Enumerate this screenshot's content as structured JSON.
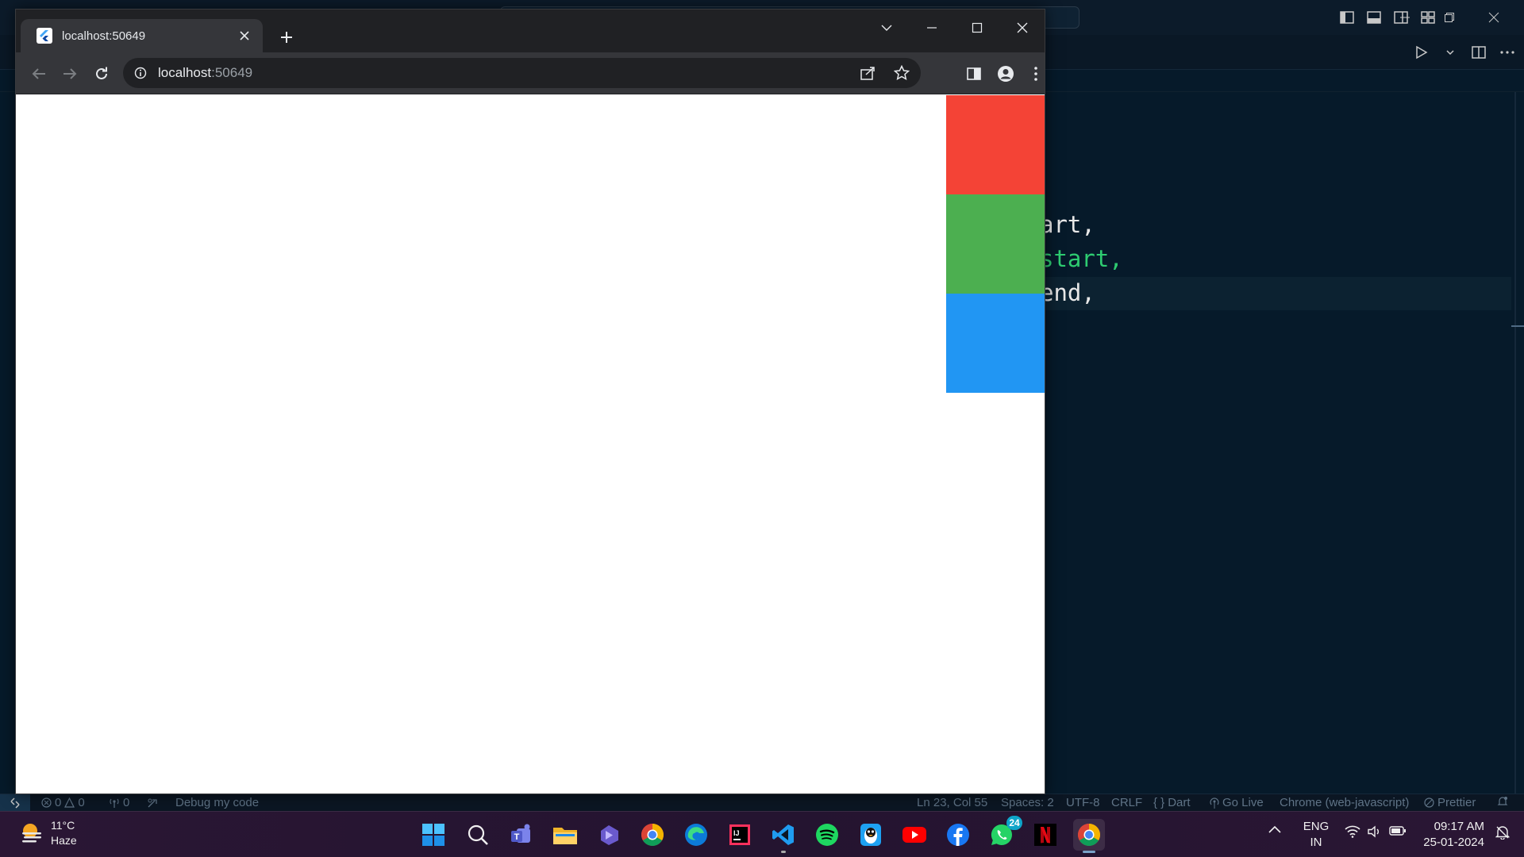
{
  "vscode": {
    "code_lines": [
      {
        "text": "art,",
        "color": "#e8e8e8"
      },
      {
        "text": "start,",
        "color": "#2ecc71"
      },
      {
        "text": "end,",
        "color": "#e8e8e8"
      }
    ],
    "statusbar": {
      "errors": "0",
      "warnings": "0",
      "ports": "0",
      "debug": "Debug my code",
      "position": "Ln 23, Col 55",
      "spaces": "Spaces: 2",
      "encoding": "UTF-8",
      "eol": "CRLF",
      "language": "Dart",
      "golive": "Go Live",
      "debugger": "Chrome (web-javascript)",
      "formatter": "Prettier"
    }
  },
  "chrome": {
    "tab_title": "localhost:50649",
    "url_host": "localhost",
    "url_port": ":50649",
    "boxes": [
      {
        "name": "red-box",
        "color": "#f44336"
      },
      {
        "name": "green-box",
        "color": "#4caf50"
      },
      {
        "name": "blue-box",
        "color": "#2196f3"
      }
    ]
  },
  "taskbar": {
    "weather_temp": "11°C",
    "weather_desc": "Haze",
    "whatsapp_badge": "24",
    "lang_line1": "ENG",
    "lang_line2": "IN",
    "time": "09:17 AM",
    "date": "25-01-2024",
    "apps": [
      "start",
      "search",
      "teams",
      "file-explorer",
      "vscode-insiders",
      "chrome",
      "edge",
      "intellij",
      "vscode",
      "spotify",
      "qq",
      "youtube",
      "facebook",
      "whatsapp",
      "netflix",
      "chrome-active"
    ]
  }
}
